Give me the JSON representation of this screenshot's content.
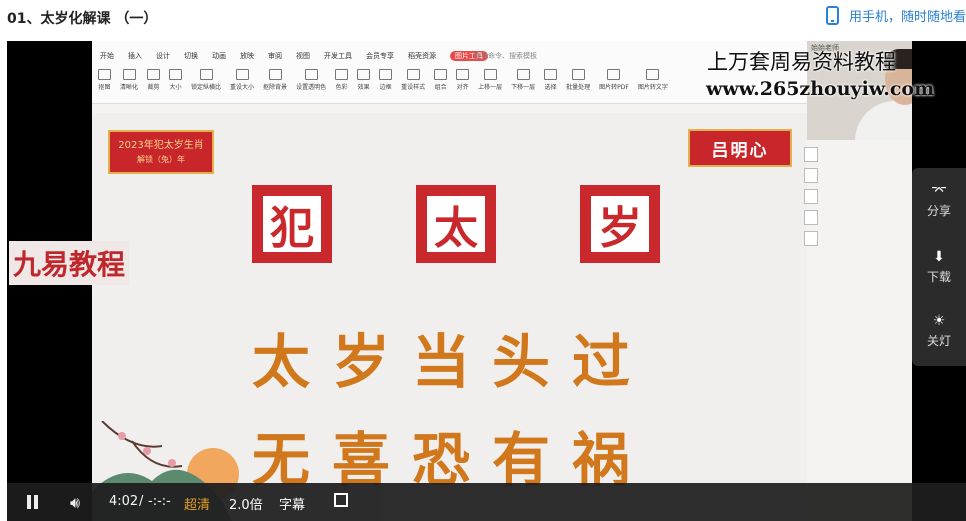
{
  "header": {
    "course_title": "01、太岁化解课 （一）",
    "mobile_link": "用手机，随时随地看",
    "mobile_icon": "phone-icon"
  },
  "ribbon": {
    "tabs": [
      "开始",
      "插入",
      "设计",
      "切换",
      "动画",
      "放映",
      "审阅",
      "视图",
      "开发工具",
      "会员专享",
      "稻壳资源",
      "图片工具"
    ],
    "active_tab": "图片工具",
    "search": "查找命令、搜索模板",
    "tools": [
      "抠图",
      "清晰化",
      "裁剪",
      "大小",
      "锁定纵横比",
      "重设大小",
      "抠除背景",
      "设置透明色",
      "色彩",
      "效果",
      "边框",
      "重设样式",
      "组合",
      "对齐",
      "上移一层",
      "下移一层",
      "选择",
      "批量处理",
      "图片转PDF",
      "图片转文字"
    ]
  },
  "slide": {
    "badge_line1": "2023年犯太岁生肖",
    "badge_line2": "解锁（兔）年",
    "seals": [
      "犯",
      "太",
      "岁"
    ],
    "poem_line1": "太岁当头过",
    "poem_line2": "无喜恐有祸",
    "nameplate": "吕明心"
  },
  "webcam": {
    "label": "始始老师"
  },
  "watermarks": {
    "title": "上万套周易资料教程",
    "url": "www.265zhouyiw.com",
    "left": "九易教程"
  },
  "float_panel": {
    "items": [
      {
        "icon": "share-icon",
        "label": "分享"
      },
      {
        "icon": "download-icon",
        "label": "下载"
      },
      {
        "icon": "lightbulb-icon",
        "label": "关灯"
      }
    ]
  },
  "controls": {
    "time": "4:02",
    "separator": "/",
    "duration": "-:-:-",
    "quality": "超清",
    "speed": "2.0倍",
    "subtitles": "字幕",
    "quality_color": "#f0a21a"
  }
}
